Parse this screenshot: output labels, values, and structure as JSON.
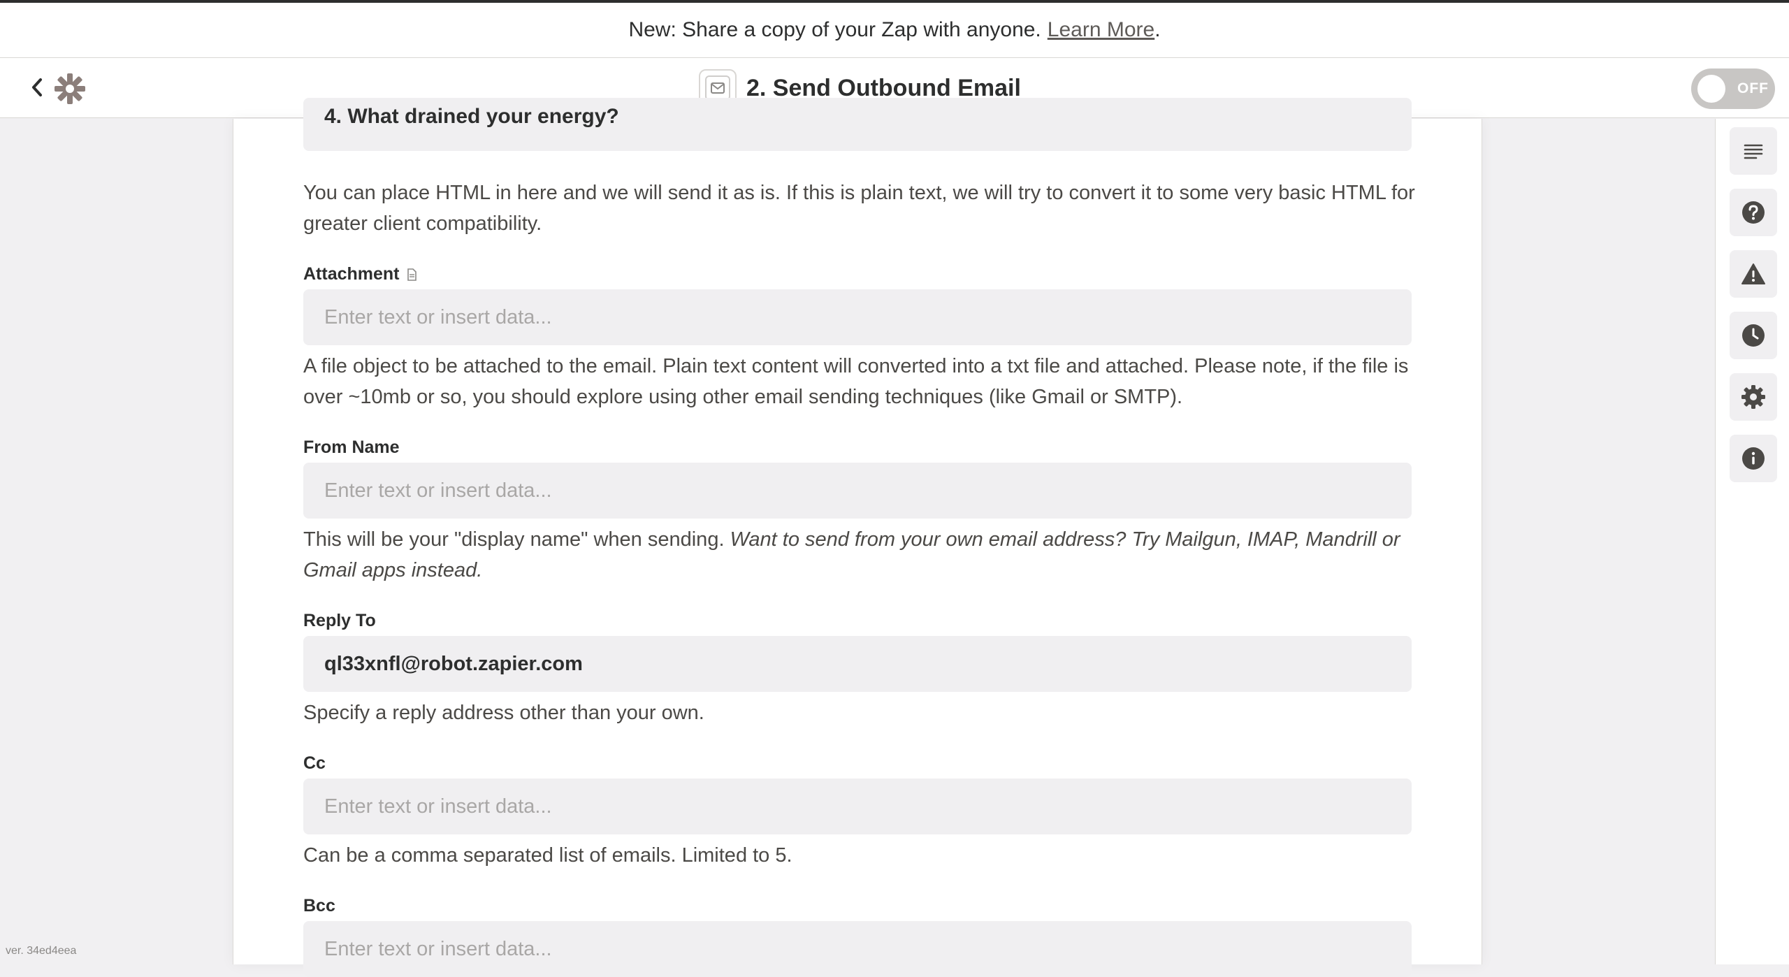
{
  "banner": {
    "text": "New: Share a copy of your Zap with anyone.",
    "link_label": "Learn More",
    "suffix": "."
  },
  "header": {
    "step_title": "2. Send Outbound Email",
    "toggle_label": "OFF"
  },
  "form": {
    "cutoff_body_text": "4. What drained your energy?",
    "body_help": "You can place HTML in here and we will send it as is. If this is plain text, we will try to convert it to some very basic HTML for greater client compatibility.",
    "attachment": {
      "label": "Attachment",
      "placeholder": "Enter text or insert data...",
      "help": "A file object to be attached to the email. Plain text content will converted into a txt file and attached. Please note, if the file is over ~10mb or so, you should explore using other email sending techniques (like Gmail or SMTP)."
    },
    "from_name": {
      "label": "From Name",
      "placeholder": "Enter text or insert data...",
      "help_plain": "This will be your \"display name\" when sending.",
      "help_italic": "Want to send from your own email address? Try Mailgun, IMAP, Mandrill or Gmail apps instead."
    },
    "reply_to": {
      "label": "Reply To",
      "value": "ql33xnfl@robot.zapier.com",
      "help": "Specify a reply address other than your own."
    },
    "cc": {
      "label": "Cc",
      "placeholder": "Enter text or insert data...",
      "help": "Can be a comma separated list of emails. Limited to 5."
    },
    "bcc": {
      "label": "Bcc",
      "placeholder": "Enter text or insert data..."
    }
  },
  "sidebar": {
    "icons": [
      "outline-icon",
      "help-icon",
      "warning-icon",
      "history-icon",
      "settings-icon",
      "info-icon"
    ]
  },
  "footer": {
    "version": "ver. 34ed4eea"
  },
  "colors": {
    "accent": "#ff4a00",
    "logo": "#8b7e7a",
    "toggle_off": "#c8c6c4",
    "input_bg": "#f0eff1"
  }
}
